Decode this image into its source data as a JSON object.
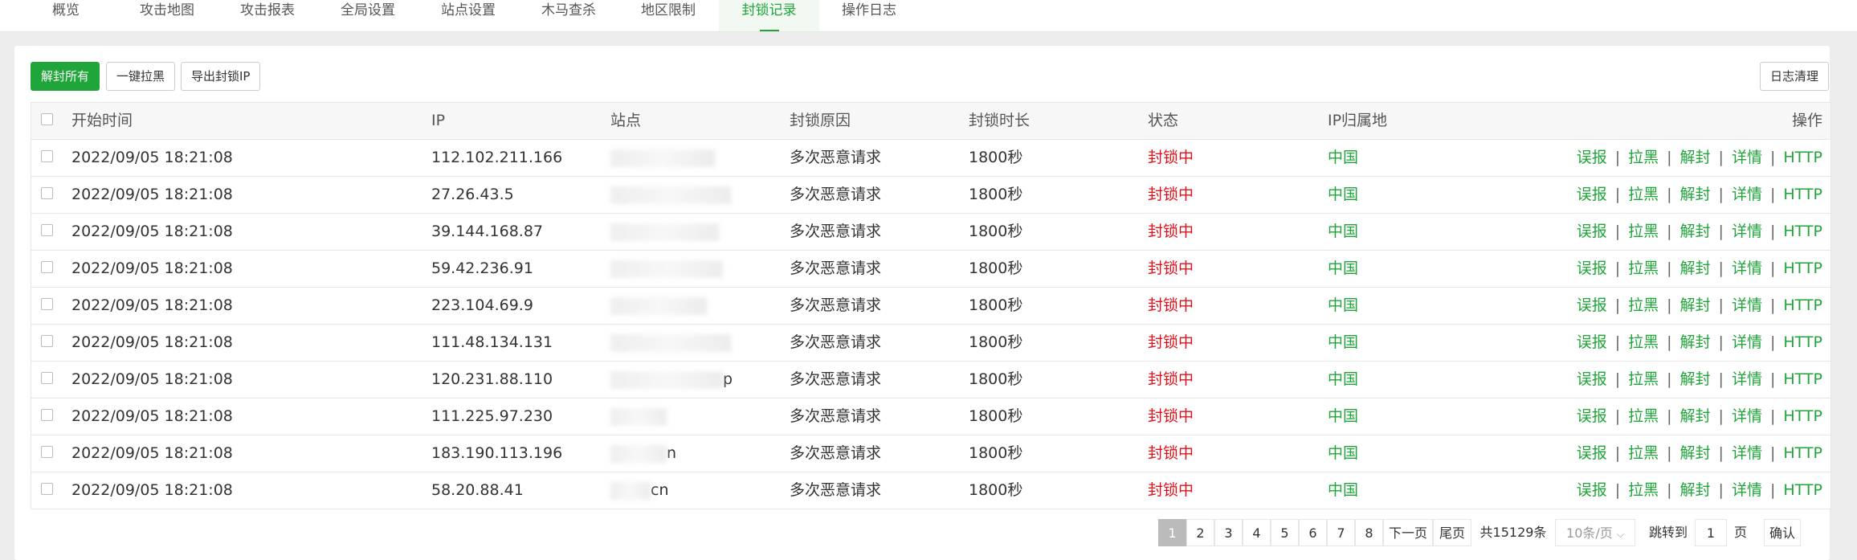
{
  "tabs": [
    {
      "label": "概览"
    },
    {
      "label": "攻击地图"
    },
    {
      "label": "攻击报表"
    },
    {
      "label": "全局设置"
    },
    {
      "label": "站点设置"
    },
    {
      "label": "木马查杀"
    },
    {
      "label": "地区限制"
    },
    {
      "label": "封锁记录",
      "active": true
    },
    {
      "label": "操作日志"
    }
  ],
  "toolbar": {
    "unblock_all": "解封所有",
    "one_click_blacklist": "一键拉黑",
    "export_ip": "导出封锁IP",
    "clear_log": "日志清理"
  },
  "table": {
    "headers": {
      "start_time": "开始时间",
      "ip": "IP",
      "site": "站点",
      "reason": "封锁原因",
      "duration": "封锁时长",
      "status": "状态",
      "location": "IP归属地",
      "actions": "操作"
    },
    "rows": [
      {
        "time": "2022/09/05 18:21:08",
        "ip": "112.102.211.166",
        "site_hint": "",
        "reason": "多次恶意请求",
        "duration": "1800秒",
        "status": "封锁中",
        "location": "中国"
      },
      {
        "time": "2022/09/05 18:21:08",
        "ip": "27.26.43.5",
        "site_hint": "",
        "reason": "多次恶意请求",
        "duration": "1800秒",
        "status": "封锁中",
        "location": "中国"
      },
      {
        "time": "2022/09/05 18:21:08",
        "ip": "39.144.168.87",
        "site_hint": "",
        "reason": "多次恶意请求",
        "duration": "1800秒",
        "status": "封锁中",
        "location": "中国"
      },
      {
        "time": "2022/09/05 18:21:08",
        "ip": "59.42.236.91",
        "site_hint": "",
        "reason": "多次恶意请求",
        "duration": "1800秒",
        "status": "封锁中",
        "location": "中国"
      },
      {
        "time": "2022/09/05 18:21:08",
        "ip": "223.104.69.9",
        "site_hint": "",
        "reason": "多次恶意请求",
        "duration": "1800秒",
        "status": "封锁中",
        "location": "中国"
      },
      {
        "time": "2022/09/05 18:21:08",
        "ip": "111.48.134.131",
        "site_hint": "",
        "reason": "多次恶意请求",
        "duration": "1800秒",
        "status": "封锁中",
        "location": "中国"
      },
      {
        "time": "2022/09/05 18:21:08",
        "ip": "120.231.88.110",
        "site_hint": "p",
        "reason": "多次恶意请求",
        "duration": "1800秒",
        "status": "封锁中",
        "location": "中国"
      },
      {
        "time": "2022/09/05 18:21:08",
        "ip": "111.225.97.230",
        "site_hint": "",
        "reason": "多次恶意请求",
        "duration": "1800秒",
        "status": "封锁中",
        "location": "中国"
      },
      {
        "time": "2022/09/05 18:21:08",
        "ip": "183.190.113.196",
        "site_hint": "n",
        "reason": "多次恶意请求",
        "duration": "1800秒",
        "status": "封锁中",
        "location": "中国"
      },
      {
        "time": "2022/09/05 18:21:08",
        "ip": "58.20.88.41",
        "site_hint": "cn",
        "reason": "多次恶意请求",
        "duration": "1800秒",
        "status": "封锁中",
        "location": "中国"
      }
    ],
    "actions": [
      "误报",
      "拉黑",
      "解封",
      "详情",
      "HTTP"
    ],
    "action_separator": "|"
  },
  "pagination": {
    "pages": [
      "1",
      "2",
      "3",
      "4",
      "5",
      "6",
      "7",
      "8"
    ],
    "current": "1",
    "next": "下一页",
    "last": "尾页",
    "total": "共15129条",
    "per_page": "10条/页",
    "jump_to": "跳转到",
    "jump_value": "1",
    "page_unit": "页",
    "confirm": "确认"
  },
  "colors": {
    "accent": "#20a53a",
    "danger": "#e0101a"
  }
}
